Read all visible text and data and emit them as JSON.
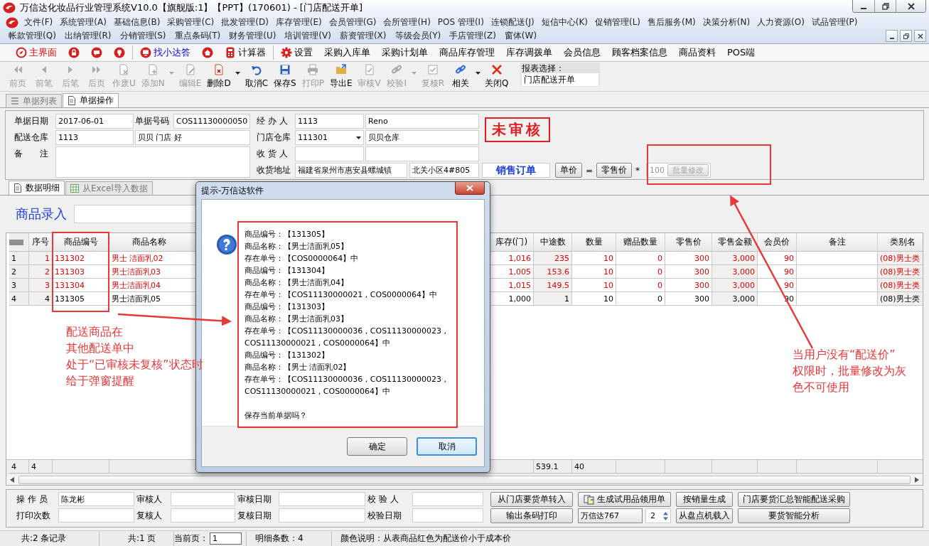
{
  "window": {
    "title": "万信达化妆品行业管理系统V10.0【旗舰版:1】【PPT】(170601) - [门店配送开单]"
  },
  "menu_rows": [
    [
      "文件(F)",
      "系统管理(A)",
      "基础信息(B)",
      "采购管理(C)",
      "批发管理(D)",
      "库存管理(E)",
      "会员管理(G)",
      "会所管理(H)",
      "POS 管理(I)",
      "连锁配送(J)",
      "短信中心(K)",
      "促销管理(L)",
      "售后服务(M)",
      "决策分析(N)",
      "人力资源(O)",
      "试品管理(P)"
    ],
    [
      "帐款管理(Q)",
      "出纳管理(R)",
      "分销管理(S)",
      "重点条码(T)",
      "财务管理(U)",
      "培训管理(V)",
      "薪资管理(X)",
      "等级会员(Y)",
      "手店管理(Z)",
      "窗体(W)"
    ]
  ],
  "quick_bar": [
    {
      "kind": "compass",
      "label": "主界面"
    },
    {
      "kind": "lock"
    },
    {
      "kind": "chat"
    },
    {
      "kind": "bulb"
    },
    {
      "kind": "separator"
    },
    {
      "kind": "monitor",
      "label": "找小达答"
    },
    {
      "kind": "house"
    },
    {
      "kind": "calculator",
      "label": "计算器"
    },
    {
      "kind": "separator"
    },
    {
      "kind": "gear",
      "label": "设置"
    },
    {
      "kind": "text",
      "label": "采购入库单"
    },
    {
      "kind": "text",
      "label": "采购计划单"
    },
    {
      "kind": "text",
      "label": "商品库存管理"
    },
    {
      "kind": "text",
      "label": "库存调拨单"
    },
    {
      "kind": "text",
      "label": "会员信息"
    },
    {
      "kind": "text",
      "label": "顾客档案信息"
    },
    {
      "kind": "text",
      "label": "商品资料"
    },
    {
      "kind": "text",
      "label": "POS端"
    }
  ],
  "toolbar": [
    {
      "kind": "first",
      "label": "前页",
      "disabled": true
    },
    {
      "kind": "prev",
      "label": "前笔",
      "disabled": true
    },
    {
      "kind": "next",
      "label": "后笔",
      "disabled": true
    },
    {
      "kind": "last",
      "label": "后页",
      "disabled": true
    },
    {
      "kind": "void",
      "label": "作废U",
      "disabled": true
    },
    {
      "kind": "add",
      "label": "添加N",
      "disabled": true
    },
    {
      "kind": "caret",
      "disabled": true
    },
    {
      "kind": "edit",
      "label": "编辑E",
      "disabled": true
    },
    {
      "kind": "delete",
      "label": "删除D",
      "disabled": false
    },
    {
      "kind": "caret",
      "disabled": false
    },
    {
      "kind": "undo",
      "label": "取消C",
      "disabled": false
    },
    {
      "kind": "save",
      "label": "保存S",
      "disabled": false
    },
    {
      "kind": "print",
      "label": "打印P",
      "disabled": true
    },
    {
      "kind": "export",
      "label": "导出E",
      "disabled": false
    },
    {
      "kind": "audit",
      "label": "审核V",
      "disabled": true
    },
    {
      "kind": "verify",
      "label": "校验I",
      "disabled": true
    },
    {
      "kind": "caret",
      "disabled": true
    },
    {
      "kind": "review",
      "label": "复核R",
      "disabled": true
    },
    {
      "kind": "link",
      "label": "相关",
      "disabled": false
    },
    {
      "kind": "caret",
      "disabled": false
    },
    {
      "kind": "close",
      "label": "关闭Q",
      "disabled": false
    }
  ],
  "report": {
    "label": "报表选择：",
    "value": "门店配送开单"
  },
  "doc_tabs": [
    {
      "label": "单据列表",
      "selected": false
    },
    {
      "label": "单据操作",
      "selected": true
    }
  ],
  "form": {
    "doc_date": {
      "label": "单据日期",
      "value": "2017-06-01"
    },
    "doc_number": {
      "label": "单据号码",
      "value": "COS11130000050"
    },
    "handler": {
      "label": "经 办 人",
      "code": "1113",
      "name": "Reno"
    },
    "source_warehouse": {
      "label": "配送仓库",
      "code": "1113",
      "name": "贝贝 门店 好"
    },
    "store_warehouse": {
      "label": "门店仓库",
      "code": "111301",
      "name": "贝贝仓库",
      "dropdown": true
    },
    "remark": {
      "label": "备　　注"
    },
    "receiver": {
      "label": "收 货 人"
    },
    "address": {
      "label": "收货地址",
      "line_1": "福建省泉州市惠安县螺城镇",
      "line_2": "北关小区4#805"
    },
    "status_stamp": "未审核",
    "order_type": "销售订单",
    "price_from": "单价",
    "equals": "=",
    "price_to": "零售价",
    "times": "*",
    "batch": {
      "value": "100",
      "button": "批量修改",
      "disabled": true
    }
  },
  "detail_tabs": [
    {
      "label": "数据明细",
      "selected": true
    },
    {
      "label": "从Excel导入数据",
      "selected": false
    }
  ],
  "entry": {
    "label": "商品录入"
  },
  "table": {
    "columns": [
      "序号",
      "商品编号",
      "商品名称",
      "库存(门)",
      "中途数",
      "数量",
      "赠品数量",
      "零售价",
      "零售金额",
      "会员价",
      "备注",
      "类别名"
    ],
    "rows": [
      {
        "row_header": "1",
        "seq": "1",
        "code": "131302",
        "name": "男士 洁面乳02",
        "stock": "1,016",
        "in_transit": "235",
        "qty": "10",
        "gift_qty": "0",
        "retail_price": "300",
        "retail_amount": "3,000",
        "member_price": "90",
        "category": "(08)男士类",
        "warning": true
      },
      {
        "row_header": "2",
        "seq": "2",
        "code": "131303",
        "name": "男士洁面乳03",
        "stock": "1,005",
        "in_transit": "153.6",
        "qty": "10",
        "gift_qty": "0",
        "retail_price": "300",
        "retail_amount": "3,000",
        "member_price": "90",
        "category": "(08)男士类",
        "warning": true
      },
      {
        "row_header": "3",
        "seq": "3",
        "code": "131304",
        "name": "男士洁面乳04",
        "stock": "1,015",
        "in_transit": "149.5",
        "qty": "10",
        "gift_qty": "0",
        "retail_price": "300",
        "retail_amount": "3,000",
        "member_price": "90",
        "category": "(08)男士类",
        "warning": true
      },
      {
        "row_header": "4",
        "seq": "4",
        "code": "131305",
        "name": "男士洁面乳05",
        "stock": "1,000",
        "in_transit": "1",
        "qty": "10",
        "gift_qty": "0",
        "retail_price": "300",
        "retail_amount": "3,000",
        "member_price": "90",
        "category": "(08)男士类",
        "warning": false
      }
    ],
    "footer": {
      "row_header": "4",
      "seq": "4",
      "in_transit": "539.1",
      "qty": "40"
    }
  },
  "dialog": {
    "title": "提示-万信达软件",
    "lines": [
      "商品编号：【131305】",
      "商品名称：【男士洁面乳05】",
      "存在单号：【COS0000064】中",
      "商品编号：【131304】",
      "商品名称：【男士洁面乳04】",
      "存在单号：【COS11130000021 , COS0000064】中",
      "商品编号：【131303】",
      "商品名称：【男士洁面乳03】",
      "存在单号：【COS11130000036 , COS11130000023 , COS11130000021 , COS0000064】中",
      "商品编号：【131302】",
      "商品名称：【男士 洁面乳02】",
      "存在单号：【COS11130000036 , COS11130000023 , COS11130000021 , COS0000064】中"
    ],
    "question": "保存当前单据吗？",
    "buttons": [
      {
        "label": "确定",
        "focused": false
      },
      {
        "label": "取消",
        "focused": true
      }
    ]
  },
  "signoff": {
    "fields": [
      {
        "label": "操 作 员",
        "value": "陈龙彬"
      },
      {
        "label": "审核人"
      },
      {
        "label": "审核日期"
      },
      {
        "label": "校 验 人"
      },
      {
        "label": "打印次数"
      },
      {
        "label": "复核人"
      },
      {
        "label": "复核日期"
      },
      {
        "label": "校验日期"
      }
    ],
    "action_rows": [
      [
        {
          "kind": "button",
          "label": "从门店要货单转入"
        },
        {
          "kind": "icon_button",
          "label": "生成试用品领用单"
        },
        {
          "kind": "button",
          "label": "按销量生成"
        },
        {
          "kind": "button",
          "label": "门店要货汇总智能配送采购"
        }
      ],
      [
        {
          "kind": "button",
          "label": "输出条码打印"
        },
        {
          "kind": "field",
          "value": "万信达767"
        },
        {
          "kind": "spinner",
          "value": "2"
        },
        {
          "kind": "button",
          "label": "从盘点机载入"
        },
        {
          "kind": "button",
          "label": "要货智能分析"
        }
      ]
    ]
  },
  "status_bar": {
    "records": "共:2 条记录",
    "pages": "共:1 页",
    "current_page": {
      "label": "当前页：",
      "value": "1"
    },
    "detail_count": "明细条数：4",
    "legend": "颜色说明：从表商品红色为配送价小于成本价"
  },
  "annotations": [
    {
      "lines": [
        "配送商品在",
        "其他配送单中",
        "处于“已审核未复核”状态时",
        "给于弹窗提醒"
      ]
    },
    {
      "lines": [
        "当用户没有“配送价”",
        "权限时，批量修改为灰",
        "色不可使用"
      ]
    }
  ]
}
